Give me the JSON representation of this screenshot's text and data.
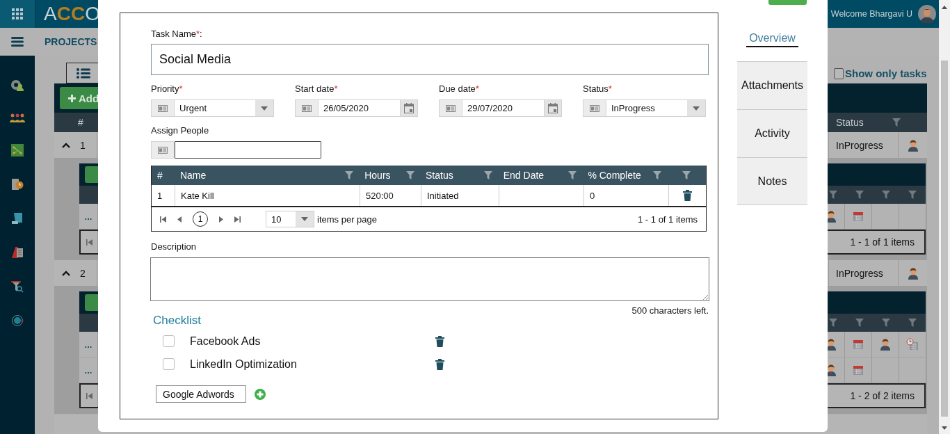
{
  "header": {
    "logo": [
      {
        "text": "A",
        "accent": false
      },
      {
        "text": "CC",
        "accent": true
      },
      {
        "text": "O",
        "accent": false
      }
    ],
    "welcome": "Welcome Bhargavi U"
  },
  "nav": {
    "title": "PROJECTS"
  },
  "board": {
    "show_only_tasks": {
      "label": "Show only tasks",
      "checked": false
    },
    "add_label": "Add",
    "columns": {
      "number": "#",
      "status": "Status"
    },
    "projects": [
      {
        "number": "1",
        "expanded": true,
        "status": "InProgress",
        "tasks": [
          {
            "menu": "...",
            "icons": [
              {
                "kind": "person"
              },
              {
                "kind": "calendar"
              }
            ]
          }
        ],
        "summary": "1 - 1 of 1 items"
      },
      {
        "number": "2",
        "expanded": true,
        "status": "InProgress",
        "tasks": [
          {
            "menu": "...",
            "icons": [
              {
                "kind": "person"
              },
              {
                "kind": "calendar"
              },
              {
                "kind": "person"
              },
              {
                "kind": "clock"
              }
            ]
          },
          {
            "menu": "...",
            "icons": [
              {
                "kind": "person"
              },
              {
                "kind": "calendar"
              }
            ]
          }
        ],
        "summary": "1 - 2 of 2 items"
      }
    ]
  },
  "task_form": {
    "task_name": {
      "label": "Task Name",
      "mark": "*",
      "suffix": ":",
      "value": "Social Media"
    },
    "fields": [
      {
        "kind": "dropdown",
        "label": "Priority",
        "mark": "*",
        "value": "Urgent"
      },
      {
        "kind": "date",
        "label": "Start date",
        "mark": "*",
        "value": "26/05/2020"
      },
      {
        "kind": "date",
        "label": "Due date",
        "mark": "*",
        "value": "29/07/2020"
      },
      {
        "kind": "dropdown",
        "label": "Status",
        "mark": "*",
        "value": "InProgress"
      }
    ],
    "assign_people": {
      "label": "Assign People"
    },
    "people_grid": {
      "columns": [
        "#",
        "Name",
        "Hours",
        "Status",
        "End Date",
        "% Complete"
      ],
      "rows": [
        {
          "number": "1",
          "name": "Kate Kill",
          "hours": "520:00",
          "status": "Initiated",
          "complete": "0"
        }
      ],
      "pager": {
        "current_page": "1",
        "page_size": "10",
        "page_size_label": "items per page",
        "summary": "1 - 1 of 1 items"
      }
    },
    "description": {
      "label": "Description",
      "chars_left": "500 characters left."
    },
    "checklist": {
      "title": "Checklist",
      "items": [
        {
          "label": "Facebook Ads",
          "checked": false
        },
        {
          "label": "LinkedIn Optimization",
          "checked": false
        }
      ],
      "new_item": "Google Adwords"
    }
  },
  "side_tabs": [
    {
      "label": "Overview",
      "selected": true
    },
    {
      "label": "Attachments",
      "selected": false
    },
    {
      "label": "Activity",
      "selected": false
    },
    {
      "label": "Notes",
      "selected": false
    }
  ]
}
